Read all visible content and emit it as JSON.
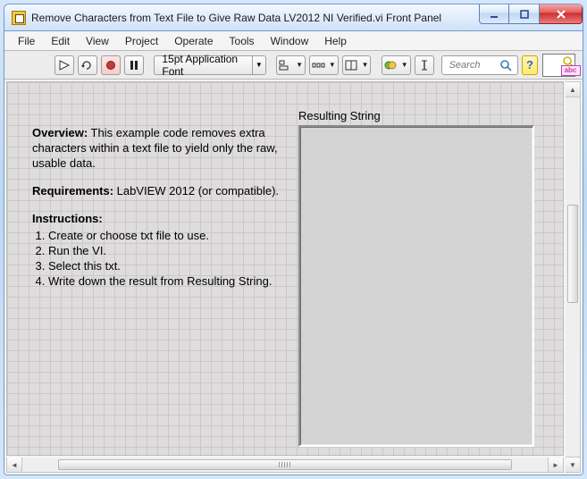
{
  "window": {
    "title": "Remove Characters from Text File to Give Raw Data LV2012 NI Verified.vi Front Panel"
  },
  "menu": {
    "items": [
      "File",
      "Edit",
      "View",
      "Project",
      "Operate",
      "Tools",
      "Window",
      "Help"
    ]
  },
  "toolbar": {
    "font_label": "15pt Application Font",
    "search_placeholder": "Search",
    "help_glyph": "?",
    "context_help_abc": "abc"
  },
  "doc": {
    "overview_label": "Overview:",
    "overview_text": "This example code removes extra characters within a text file to yield only the raw, usable data.",
    "requirements_label": "Requirements:",
    "requirements_text": "LabVIEW 2012 (or compatible).",
    "instructions_label": "Instructions:",
    "steps": [
      "Create or choose txt file to use.",
      "Run the VI.",
      "Select this txt.",
      "Write down the result from Resulting String."
    ]
  },
  "indicator": {
    "label": "Resulting String",
    "value": ""
  }
}
